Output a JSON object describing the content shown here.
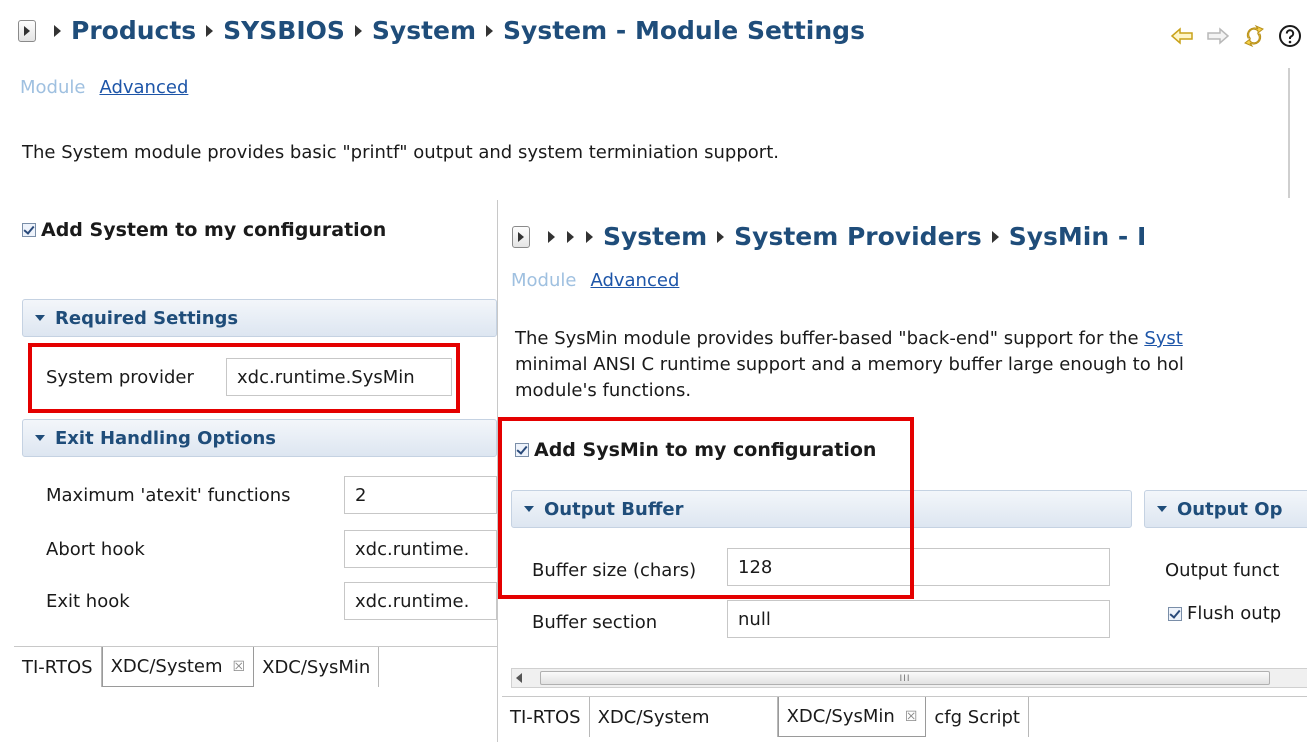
{
  "back": {
    "crumbs": [
      "Products",
      "SYSBIOS",
      "System",
      "System - Module Settings"
    ],
    "subtabs": {
      "module": "Module",
      "advanced": "Advanced"
    },
    "description": "The System module provides basic \"printf\" output and system terminiation support.",
    "add_checkbox_label": "Add System to my configuration",
    "required_header": "Required Settings",
    "system_provider_label": "System provider",
    "system_provider_value": "xdc.runtime.SysMin",
    "exit_header": "Exit Handling Options",
    "max_atexit_label": "Maximum 'atexit' functions",
    "max_atexit_value": "2",
    "abort_hook_label": "Abort hook",
    "abort_hook_value": "xdc.runtime.",
    "exit_hook_label": "Exit hook",
    "exit_hook_value": "xdc.runtime.",
    "tabs": [
      "TI-RTOS",
      "XDC/System",
      "XDC/SysMin"
    ],
    "close_glyph": "☒"
  },
  "front": {
    "crumbs": [
      "System",
      "System Providers",
      "SysMin - I"
    ],
    "subtabs": {
      "module": "Module",
      "advanced": "Advanced"
    },
    "description_line1": "The SysMin module provides buffer-based \"back-end\" support for the ",
    "description_link": "Syst",
    "description_line2": "minimal ANSI C runtime support and a memory buffer large enough to hol",
    "description_line3": "module's functions.",
    "add_checkbox_label": "Add SysMin to my configuration",
    "output_buffer_header": "Output Buffer",
    "output_options_header": "Output Op",
    "buffer_size_label": "Buffer size (chars)",
    "buffer_size_value": "128",
    "buffer_section_label": "Buffer section",
    "buffer_section_value": "null",
    "output_func_label": "Output funct",
    "flush_label": "Flush outp",
    "tabs": [
      "TI-RTOS",
      "XDC/System",
      "XDC/SysMin",
      "cfg Script"
    ],
    "close_glyph": "☒",
    "scroll_grip": "III"
  },
  "colors": {
    "crumb": "#1f4d7a",
    "link": "#1d55a8",
    "highlight": "#e40000"
  }
}
